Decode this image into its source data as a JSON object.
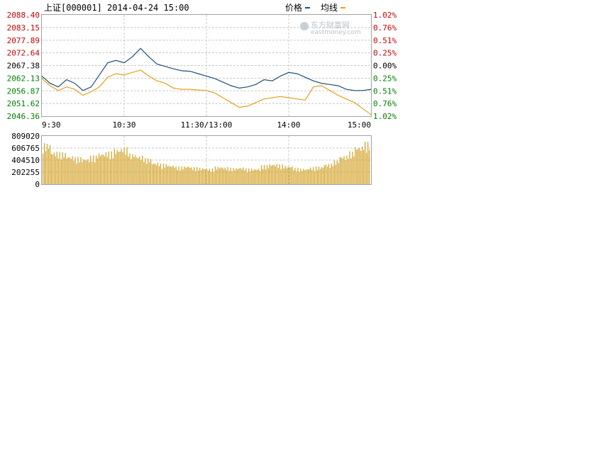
{
  "header": {
    "title": "上证[000001] 2014-04-24 15:00",
    "legend_price": "价格",
    "legend_avg": "均线"
  },
  "watermark": {
    "cn": "东方财富网",
    "en": "eastmoney.com"
  },
  "colors": {
    "price_line": "#1f4e79",
    "avg_line": "#e3a21a",
    "volume_bar": "#d2a021",
    "up": "#cc0000",
    "down": "#008000",
    "flat": "#000000",
    "grid": "#c8c8c8",
    "frame": "#a0a0a0"
  },
  "chart_data": [
    {
      "type": "line",
      "title": "上证[000001] 2014-04-24 15:00",
      "xlabel": "",
      "ylabel": "",
      "x_ticks": [
        "9:30",
        "10:30",
        "11:30/13:00",
        "14:00",
        "15:00"
      ],
      "y_ticks_left": [
        "2088.40",
        "2083.15",
        "2077.89",
        "2072.64",
        "2067.38",
        "2062.13",
        "2056.87",
        "2051.62",
        "2046.36"
      ],
      "y_ticks_right": [
        "1.02%",
        "0.76%",
        "0.51%",
        "0.25%",
        "0.00%",
        "0.25%",
        "0.51%",
        "0.76%",
        "1.02%"
      ],
      "ylim": [
        2046.36,
        2088.4
      ],
      "prev_close": 2067.38,
      "grid": true,
      "legend_position": "top-right",
      "x": [
        0,
        6,
        12,
        18,
        24,
        30,
        36,
        42,
        48,
        54,
        60,
        66,
        72,
        78,
        84,
        90,
        96,
        102,
        108,
        114,
        120,
        126,
        132,
        138,
        144,
        150,
        156,
        162,
        168,
        174,
        180,
        186,
        192,
        198,
        204,
        210,
        216,
        222,
        228,
        234,
        240
      ],
      "series": [
        {
          "name": "价格",
          "values": [
            2063.0,
            2060.0,
            2058.5,
            2061.5,
            2060.0,
            2057.0,
            2058.5,
            2063.5,
            2068.5,
            2069.5,
            2068.5,
            2071.0,
            2074.5,
            2071.0,
            2068.0,
            2067.0,
            2066.0,
            2065.2,
            2065.0,
            2064.0,
            2063.0,
            2062.0,
            2060.5,
            2059.0,
            2058.0,
            2058.5,
            2059.5,
            2061.5,
            2061.0,
            2063.0,
            2064.5,
            2064.0,
            2062.5,
            2061.0,
            2060.0,
            2059.5,
            2059.0,
            2057.5,
            2057.0,
            2057.0,
            2057.5
          ]
        },
        {
          "name": "均线",
          "values": [
            2062.0,
            2059.0,
            2057.0,
            2058.5,
            2057.5,
            2055.0,
            2056.5,
            2058.5,
            2062.5,
            2064.0,
            2063.5,
            2064.5,
            2065.5,
            2063.0,
            2061.0,
            2060.0,
            2058.0,
            2057.5,
            2057.5,
            2057.2,
            2057.0,
            2056.0,
            2054.0,
            2052.0,
            2050.0,
            2050.5,
            2052.0,
            2053.5,
            2054.0,
            2054.5,
            2054.0,
            2053.5,
            2053.0,
            2058.5,
            2059.0,
            2057.0,
            2055.0,
            2053.5,
            2052.0,
            2049.5,
            2047.0
          ]
        }
      ]
    },
    {
      "type": "bar",
      "title": "",
      "xlabel": "",
      "ylabel": "",
      "y_ticks": [
        "809020",
        "606765",
        "404510",
        "202255",
        "0"
      ],
      "ylim": [
        0,
        809020
      ],
      "grid": true,
      "values_by_minute_group": [
        600000,
        480000,
        470000,
        420000,
        400000,
        380000,
        420000,
        460000,
        480000,
        520000,
        540000,
        450000,
        420000,
        380000,
        320000,
        300000,
        280000,
        260000,
        270000,
        250000,
        240000,
        230000,
        260000,
        250000,
        240000,
        250000,
        230000,
        230000,
        280000,
        300000,
        290000,
        270000,
        240000,
        230000,
        250000,
        260000,
        300000,
        350000,
        420000,
        480000,
        560000,
        620000
      ]
    }
  ]
}
